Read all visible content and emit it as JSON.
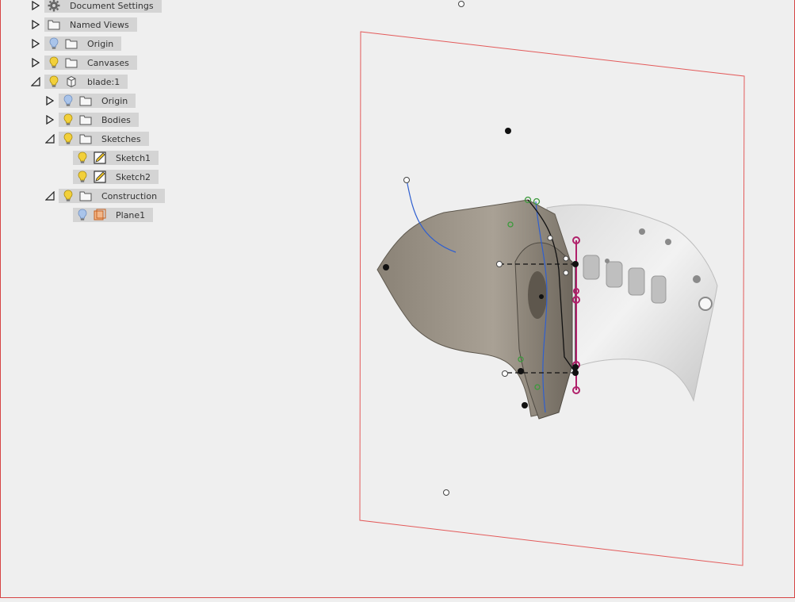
{
  "browser": {
    "items": [
      {
        "label": "Document Settings",
        "expanded": false,
        "icon": "gear-icon",
        "level": 0,
        "visible_bulb": false
      },
      {
        "label": "Named Views",
        "expanded": false,
        "icon": "folder-icon",
        "level": 0,
        "visible_bulb": false
      },
      {
        "label": "Origin",
        "expanded": false,
        "icon": "folder-icon",
        "level": 0,
        "bulb": "off"
      },
      {
        "label": "Canvases",
        "expanded": false,
        "icon": "folder-icon",
        "level": 0,
        "bulb": "on"
      },
      {
        "label": "blade:1",
        "expanded": true,
        "icon": "component-icon",
        "level": 0,
        "bulb": "on"
      },
      {
        "label": "Origin",
        "expanded": false,
        "icon": "folder-icon",
        "level": 1,
        "bulb": "off"
      },
      {
        "label": "Bodies",
        "expanded": false,
        "icon": "folder-icon",
        "level": 1,
        "bulb": "on"
      },
      {
        "label": "Sketches",
        "expanded": true,
        "icon": "folder-icon",
        "level": 1,
        "bulb": "on"
      },
      {
        "label": "Sketch1",
        "expanded": null,
        "icon": "sketch-icon",
        "level": 2,
        "bulb": "on"
      },
      {
        "label": "Sketch2",
        "expanded": null,
        "icon": "sketch-icon",
        "level": 2,
        "bulb": "on"
      },
      {
        "label": "Construction",
        "expanded": true,
        "icon": "folder-icon",
        "level": 1,
        "bulb": "on"
      },
      {
        "label": "Plane1",
        "expanded": null,
        "icon": "plane-icon",
        "level": 2,
        "bulb": "off"
      }
    ]
  },
  "colors": {
    "background": "#efefef",
    "plane_outline": "#e35a5a",
    "sketch_blue": "#2f5fd0",
    "constraint_magenta": "#b0206a",
    "pill": "#d4d4d4",
    "bulb_on": "#f2d03a",
    "bulb_off": "#a9c4ea"
  }
}
